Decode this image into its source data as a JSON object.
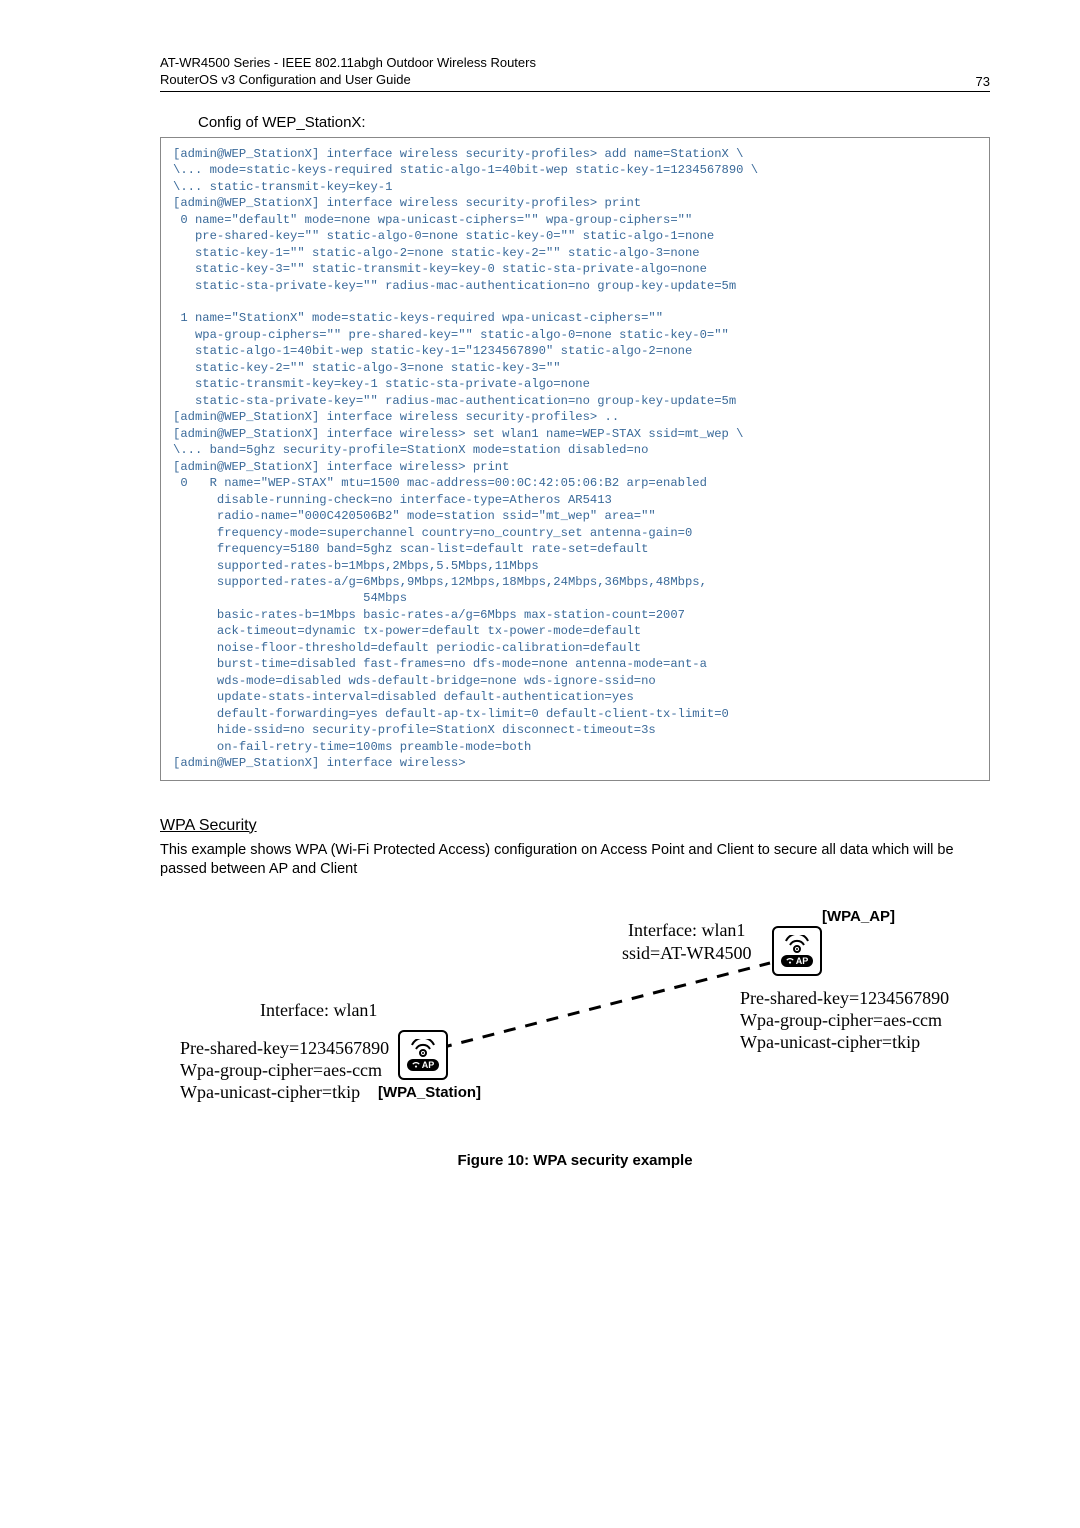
{
  "header": {
    "line1": "AT-WR4500 Series - IEEE 802.11abgh Outdoor Wireless Routers",
    "line2": "RouterOS v3 Configuration and User Guide",
    "pagenum": "73"
  },
  "config_heading": "Config of WEP_StationX:",
  "code": "[admin@WEP_StationX] interface wireless security-profiles> add name=StationX \\\n\\... mode=static-keys-required static-algo-1=40bit-wep static-key-1=1234567890 \\\n\\... static-transmit-key=key-1\n[admin@WEP_StationX] interface wireless security-profiles> print\n 0 name=\"default\" mode=none wpa-unicast-ciphers=\"\" wpa-group-ciphers=\"\"\n   pre-shared-key=\"\" static-algo-0=none static-key-0=\"\" static-algo-1=none\n   static-key-1=\"\" static-algo-2=none static-key-2=\"\" static-algo-3=none\n   static-key-3=\"\" static-transmit-key=key-0 static-sta-private-algo=none\n   static-sta-private-key=\"\" radius-mac-authentication=no group-key-update=5m\n\n 1 name=\"StationX\" mode=static-keys-required wpa-unicast-ciphers=\"\"\n   wpa-group-ciphers=\"\" pre-shared-key=\"\" static-algo-0=none static-key-0=\"\"\n   static-algo-1=40bit-wep static-key-1=\"1234567890\" static-algo-2=none\n   static-key-2=\"\" static-algo-3=none static-key-3=\"\"\n   static-transmit-key=key-1 static-sta-private-algo=none\n   static-sta-private-key=\"\" radius-mac-authentication=no group-key-update=5m\n[admin@WEP_StationX] interface wireless security-profiles> ..\n[admin@WEP_StationX] interface wireless> set wlan1 name=WEP-STAX ssid=mt_wep \\\n\\... band=5ghz security-profile=StationX mode=station disabled=no\n[admin@WEP_StationX] interface wireless> print\n 0   R name=\"WEP-STAX\" mtu=1500 mac-address=00:0C:42:05:06:B2 arp=enabled\n      disable-running-check=no interface-type=Atheros AR5413\n      radio-name=\"000C420506B2\" mode=station ssid=\"mt_wep\" area=\"\"\n      frequency-mode=superchannel country=no_country_set antenna-gain=0\n      frequency=5180 band=5ghz scan-list=default rate-set=default\n      supported-rates-b=1Mbps,2Mbps,5.5Mbps,11Mbps\n      supported-rates-a/g=6Mbps,9Mbps,12Mbps,18Mbps,24Mbps,36Mbps,48Mbps,\n                          54Mbps\n      basic-rates-b=1Mbps basic-rates-a/g=6Mbps max-station-count=2007\n      ack-timeout=dynamic tx-power=default tx-power-mode=default\n      noise-floor-threshold=default periodic-calibration=default\n      burst-time=disabled fast-frames=no dfs-mode=none antenna-mode=ant-a\n      wds-mode=disabled wds-default-bridge=none wds-ignore-ssid=no\n      update-stats-interval=disabled default-authentication=yes\n      default-forwarding=yes default-ap-tx-limit=0 default-client-tx-limit=0\n      hide-ssid=no security-profile=StationX disconnect-timeout=3s\n      on-fail-retry-time=100ms preamble-mode=both\n[admin@WEP_StationX] interface wireless>",
  "wpa_section": {
    "title": "WPA Security",
    "text": "This example shows WPA (Wi-Fi Protected Access) configuration on Access Point and Client to secure all data which will be passed between AP and Client"
  },
  "diagram": {
    "ap_label": "[WPA_AP]",
    "station_label": "[WPA_Station]",
    "ap_pill": "AP",
    "left": {
      "iface": "Interface: wlan1",
      "psk": "Pre-shared-key=1234567890",
      "group": "Wpa-group-cipher=aes-ccm",
      "unicast": "Wpa-unicast-cipher=tkip"
    },
    "right": {
      "iface": "Interface: wlan1",
      "ssid": "ssid=AT-WR4500",
      "psk": "Pre-shared-key=1234567890",
      "group": "Wpa-group-cipher=aes-ccm",
      "unicast": "Wpa-unicast-cipher=tkip"
    }
  },
  "caption": "Figure 10: WPA security example"
}
